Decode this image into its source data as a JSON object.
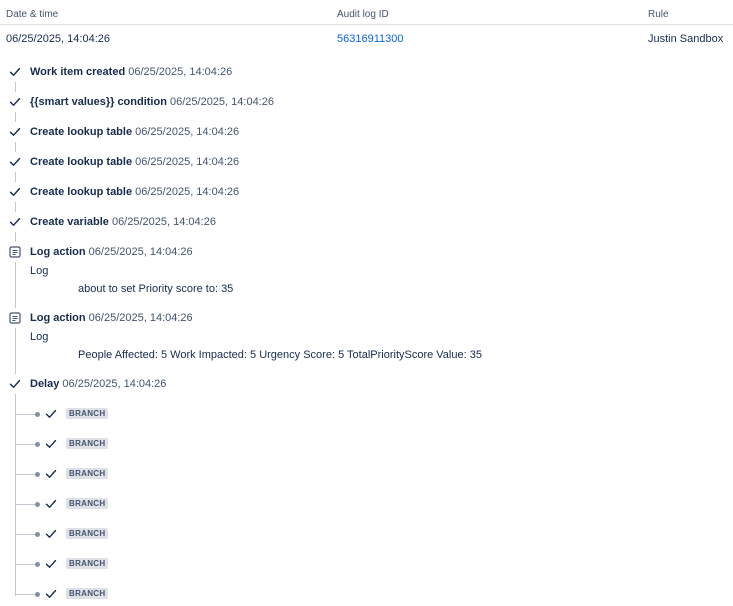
{
  "header": {
    "date_col": "Date & time",
    "audit_col": "Audit log ID",
    "rule_col": "Rule"
  },
  "entry": {
    "date": "06/25/2025, 14:04:26",
    "audit_id": "56316911300",
    "rule": "Justin Sandbox"
  },
  "timeline": [
    {
      "icon": "check-icon",
      "title": "Work item created",
      "time": "06/25/2025, 14:04:26"
    },
    {
      "icon": "check-icon",
      "title": "{{smart values}} condition",
      "time": "06/25/2025, 14:04:26"
    },
    {
      "icon": "check-icon",
      "title": "Create lookup table",
      "time": "06/25/2025, 14:04:26"
    },
    {
      "icon": "check-icon",
      "title": "Create lookup table",
      "time": "06/25/2025, 14:04:26"
    },
    {
      "icon": "check-icon",
      "title": "Create lookup table",
      "time": "06/25/2025, 14:04:26"
    },
    {
      "icon": "check-icon",
      "title": "Create variable",
      "time": "06/25/2025, 14:04:26"
    },
    {
      "icon": "log-icon",
      "title": "Log action",
      "time": "06/25/2025, 14:04:26",
      "sub_label": "Log",
      "message": "about to set Priority score to: 35"
    },
    {
      "icon": "log-icon",
      "title": "Log action",
      "time": "06/25/2025, 14:04:26",
      "sub_label": "Log",
      "message": "People Affected: 5 Work Impacted: 5 Urgency Score: 5 TotalPriorityScore Value: 35"
    },
    {
      "icon": "check-icon",
      "title": "Delay",
      "time": "06/25/2025, 14:04:26"
    }
  ],
  "branches": [
    {
      "icon": "check-icon",
      "label": "BRANCH"
    },
    {
      "icon": "check-icon",
      "label": "BRANCH"
    },
    {
      "icon": "check-icon",
      "label": "BRANCH"
    },
    {
      "icon": "check-icon",
      "label": "BRANCH"
    },
    {
      "icon": "check-icon",
      "label": "BRANCH"
    },
    {
      "icon": "check-icon",
      "label": "BRANCH"
    },
    {
      "icon": "check-icon",
      "label": "BRANCH"
    }
  ]
}
